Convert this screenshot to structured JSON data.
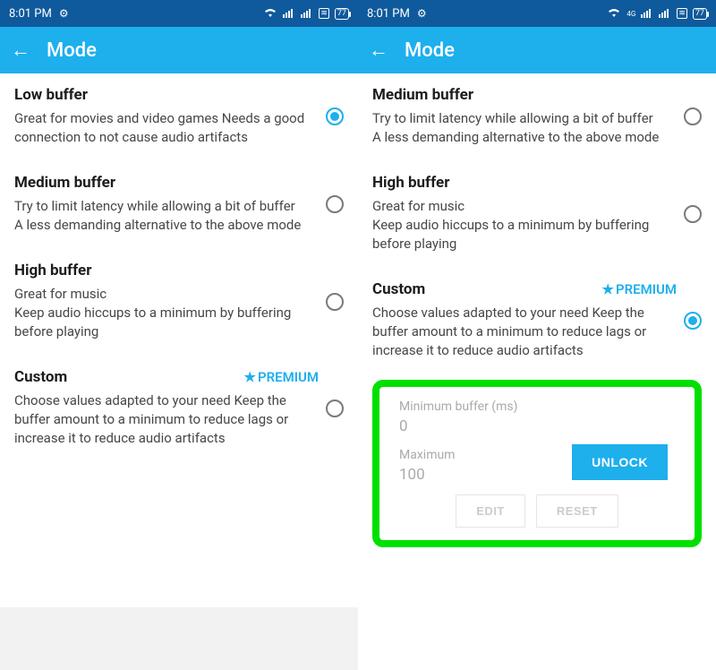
{
  "status": {
    "time": "8:01 PM",
    "battery": "77"
  },
  "header": {
    "title": "Mode"
  },
  "options": {
    "low": {
      "title": "Low buffer",
      "desc": "Great for movies and video games Needs a good connection to not cause audio artifacts"
    },
    "medium": {
      "title": "Medium buffer",
      "desc": "Try to limit latency while allowing a bit of buffer\nA less demanding alternative to the above mode"
    },
    "high": {
      "title": "High buffer",
      "desc": "Great for music\nKeep audio hiccups to a minimum by buffering before playing"
    },
    "custom": {
      "title": "Custom",
      "premium": "PREMIUM",
      "desc": "Choose values adapted to your need Keep the buffer amount to a minimum to reduce lags or increase it to reduce audio artifacts"
    }
  },
  "custom_box": {
    "min_label": "Minimum buffer (ms)",
    "min_value": "0",
    "max_label": "Maximum",
    "max_value": "100",
    "unlock": "UNLOCK",
    "edit": "EDIT",
    "reset": "RESET"
  }
}
